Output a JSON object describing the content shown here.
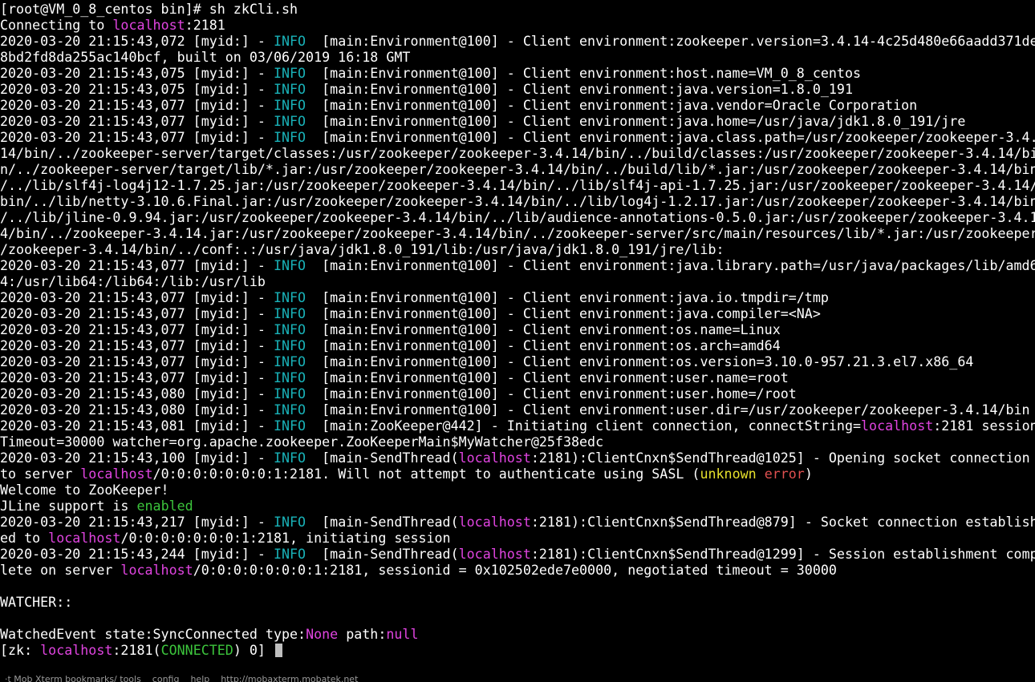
{
  "terminal": {
    "lines": [
      [
        {
          "t": "[root@VM_0_8_centos bin]# sh zkCli.sh"
        }
      ],
      [
        {
          "t": "Connecting to "
        },
        {
          "t": "localhost",
          "c": "host"
        },
        {
          "t": ":2181"
        }
      ],
      [
        {
          "t": "2020-03-20 21:15:43,072 [myid:] - "
        },
        {
          "t": "INFO",
          "c": "info"
        },
        {
          "t": "  [main:Environment@100] - Client environment:zookeeper.version=3.4.14-4c25d480e66aadd371de"
        }
      ],
      [
        {
          "t": "8bd2fd8da255ac140bcf, built on 03/06/2019 16:18 GMT"
        }
      ],
      [
        {
          "t": "2020-03-20 21:15:43,075 [myid:] - "
        },
        {
          "t": "INFO",
          "c": "info"
        },
        {
          "t": "  [main:Environment@100] - Client environment:host.name=VM_0_8_centos"
        }
      ],
      [
        {
          "t": "2020-03-20 21:15:43,075 [myid:] - "
        },
        {
          "t": "INFO",
          "c": "info"
        },
        {
          "t": "  [main:Environment@100] - Client environment:java.version=1.8.0_191"
        }
      ],
      [
        {
          "t": "2020-03-20 21:15:43,077 [myid:] - "
        },
        {
          "t": "INFO",
          "c": "info"
        },
        {
          "t": "  [main:Environment@100] - Client environment:java.vendor=Oracle Corporation"
        }
      ],
      [
        {
          "t": "2020-03-20 21:15:43,077 [myid:] - "
        },
        {
          "t": "INFO",
          "c": "info"
        },
        {
          "t": "  [main:Environment@100] - Client environment:java.home=/usr/java/jdk1.8.0_191/jre"
        }
      ],
      [
        {
          "t": "2020-03-20 21:15:43,077 [myid:] - "
        },
        {
          "t": "INFO",
          "c": "info"
        },
        {
          "t": "  [main:Environment@100] - Client environment:java.class.path=/usr/zookeeper/zookeeper-3.4."
        }
      ],
      [
        {
          "t": "14/bin/../zookeeper-server/target/classes:/usr/zookeeper/zookeeper-3.4.14/bin/../build/classes:/usr/zookeeper/zookeeper-3.4.14/bi"
        }
      ],
      [
        {
          "t": "n/../zookeeper-server/target/lib/*.jar:/usr/zookeeper/zookeeper-3.4.14/bin/../build/lib/*.jar:/usr/zookeeper/zookeeper-3.4.14/bin"
        }
      ],
      [
        {
          "t": "/../lib/slf4j-log4j12-1.7.25.jar:/usr/zookeeper/zookeeper-3.4.14/bin/../lib/slf4j-api-1.7.25.jar:/usr/zookeeper/zookeeper-3.4.14/"
        }
      ],
      [
        {
          "t": "bin/../lib/netty-3.10.6.Final.jar:/usr/zookeeper/zookeeper-3.4.14/bin/../lib/log4j-1.2.17.jar:/usr/zookeeper/zookeeper-3.4.14/bin"
        }
      ],
      [
        {
          "t": "/../lib/jline-0.9.94.jar:/usr/zookeeper/zookeeper-3.4.14/bin/../lib/audience-annotations-0.5.0.jar:/usr/zookeeper/zookeeper-3.4.1"
        }
      ],
      [
        {
          "t": "4/bin/../zookeeper-3.4.14.jar:/usr/zookeeper/zookeeper-3.4.14/bin/../zookeeper-server/src/main/resources/lib/*.jar:/usr/zookeeper"
        }
      ],
      [
        {
          "t": "/zookeeper-3.4.14/bin/../conf:.:/usr/java/jdk1.8.0_191/lib:/usr/java/jdk1.8.0_191/jre/lib:"
        }
      ],
      [
        {
          "t": "2020-03-20 21:15:43,077 [myid:] - "
        },
        {
          "t": "INFO",
          "c": "info"
        },
        {
          "t": "  [main:Environment@100] - Client environment:java.library.path=/usr/java/packages/lib/amd6"
        }
      ],
      [
        {
          "t": "4:/usr/lib64:/lib64:/lib:/usr/lib"
        }
      ],
      [
        {
          "t": "2020-03-20 21:15:43,077 [myid:] - "
        },
        {
          "t": "INFO",
          "c": "info"
        },
        {
          "t": "  [main:Environment@100] - Client environment:java.io.tmpdir=/tmp"
        }
      ],
      [
        {
          "t": "2020-03-20 21:15:43,077 [myid:] - "
        },
        {
          "t": "INFO",
          "c": "info"
        },
        {
          "t": "  [main:Environment@100] - Client environment:java.compiler=<NA>"
        }
      ],
      [
        {
          "t": "2020-03-20 21:15:43,077 [myid:] - "
        },
        {
          "t": "INFO",
          "c": "info"
        },
        {
          "t": "  [main:Environment@100] - Client environment:os.name=Linux"
        }
      ],
      [
        {
          "t": "2020-03-20 21:15:43,077 [myid:] - "
        },
        {
          "t": "INFO",
          "c": "info"
        },
        {
          "t": "  [main:Environment@100] - Client environment:os.arch=amd64"
        }
      ],
      [
        {
          "t": "2020-03-20 21:15:43,077 [myid:] - "
        },
        {
          "t": "INFO",
          "c": "info"
        },
        {
          "t": "  [main:Environment@100] - Client environment:os.version=3.10.0-957.21.3.el7.x86_64"
        }
      ],
      [
        {
          "t": "2020-03-20 21:15:43,077 [myid:] - "
        },
        {
          "t": "INFO",
          "c": "info"
        },
        {
          "t": "  [main:Environment@100] - Client environment:user.name=root"
        }
      ],
      [
        {
          "t": "2020-03-20 21:15:43,080 [myid:] - "
        },
        {
          "t": "INFO",
          "c": "info"
        },
        {
          "t": "  [main:Environment@100] - Client environment:user.home=/root"
        }
      ],
      [
        {
          "t": "2020-03-20 21:15:43,080 [myid:] - "
        },
        {
          "t": "INFO",
          "c": "info"
        },
        {
          "t": "  [main:Environment@100] - Client environment:user.dir=/usr/zookeeper/zookeeper-3.4.14/bin"
        }
      ],
      [
        {
          "t": "2020-03-20 21:15:43,081 [myid:] - "
        },
        {
          "t": "INFO",
          "c": "info"
        },
        {
          "t": "  [main:ZooKeeper@442] - Initiating client connection, connectString="
        },
        {
          "t": "localhost",
          "c": "host"
        },
        {
          "t": ":2181 session"
        }
      ],
      [
        {
          "t": "Timeout=30000 watcher=org.apache.zookeeper.ZooKeeperMain$MyWatcher@25f38edc"
        }
      ],
      [
        {
          "t": "2020-03-20 21:15:43,100 [myid:] - "
        },
        {
          "t": "INFO",
          "c": "info"
        },
        {
          "t": "  [main-SendThread("
        },
        {
          "t": "localhost",
          "c": "host"
        },
        {
          "t": ":2181):ClientCnxn$SendThread@1025] - Opening socket connection"
        }
      ],
      [
        {
          "t": "to server "
        },
        {
          "t": "localhost",
          "c": "host"
        },
        {
          "t": "/0:0:0:0:0:0:0:1:2181. Will not attempt to authenticate using SASL ("
        },
        {
          "t": "unknown",
          "c": "yellow"
        },
        {
          "t": " "
        },
        {
          "t": "error",
          "c": "red"
        },
        {
          "t": ")"
        }
      ],
      [
        {
          "t": "Welcome to ZooKeeper!"
        }
      ],
      [
        {
          "t": "JLine support is "
        },
        {
          "t": "enabled",
          "c": "green"
        }
      ],
      [
        {
          "t": "2020-03-20 21:15:43,217 [myid:] - "
        },
        {
          "t": "INFO",
          "c": "info"
        },
        {
          "t": "  [main-SendThread("
        },
        {
          "t": "localhost",
          "c": "host"
        },
        {
          "t": ":2181):ClientCnxn$SendThread@879] - Socket connection establish"
        }
      ],
      [
        {
          "t": "ed to "
        },
        {
          "t": "localhost",
          "c": "host"
        },
        {
          "t": "/0:0:0:0:0:0:0:1:2181, initiating session"
        }
      ],
      [
        {
          "t": "2020-03-20 21:15:43,244 [myid:] - "
        },
        {
          "t": "INFO",
          "c": "info"
        },
        {
          "t": "  [main-SendThread("
        },
        {
          "t": "localhost",
          "c": "host"
        },
        {
          "t": ":2181):ClientCnxn$SendThread@1299] - Session establishment comp"
        }
      ],
      [
        {
          "t": "lete on server "
        },
        {
          "t": "localhost",
          "c": "host"
        },
        {
          "t": "/0:0:0:0:0:0:0:1:2181, sessionid = 0x102502ede7e0000, negotiated timeout = 30000"
        }
      ],
      [
        {
          "t": ""
        }
      ],
      [
        {
          "t": "WATCHER::"
        }
      ],
      [
        {
          "t": ""
        }
      ],
      [
        {
          "t": "WatchedEvent state:SyncConnected type:"
        },
        {
          "t": "None",
          "c": "magenta"
        },
        {
          "t": " path:"
        },
        {
          "t": "null",
          "c": "magenta"
        }
      ],
      [
        {
          "t": "[zk: "
        },
        {
          "t": "localhost",
          "c": "host"
        },
        {
          "t": ":2181("
        },
        {
          "t": "CONNECTED",
          "c": "green"
        },
        {
          "t": ") 0] "
        }
      ]
    ],
    "prompt_cursor": "block-cursor",
    "colors": {
      "background": "#000000",
      "foreground": "#ffffff",
      "info": "#19b2b8",
      "host": "#e044e0",
      "green": "#3cc43c",
      "yellow": "#e6e02c",
      "red": "#e05050",
      "magenta": "#e044e0",
      "cursor": "#bfbfbf"
    }
  },
  "status_strip": {
    "text": "·t Mob Xterm bookmarks/ tools    config    help    http://mobaxterm.mobatek.net"
  }
}
